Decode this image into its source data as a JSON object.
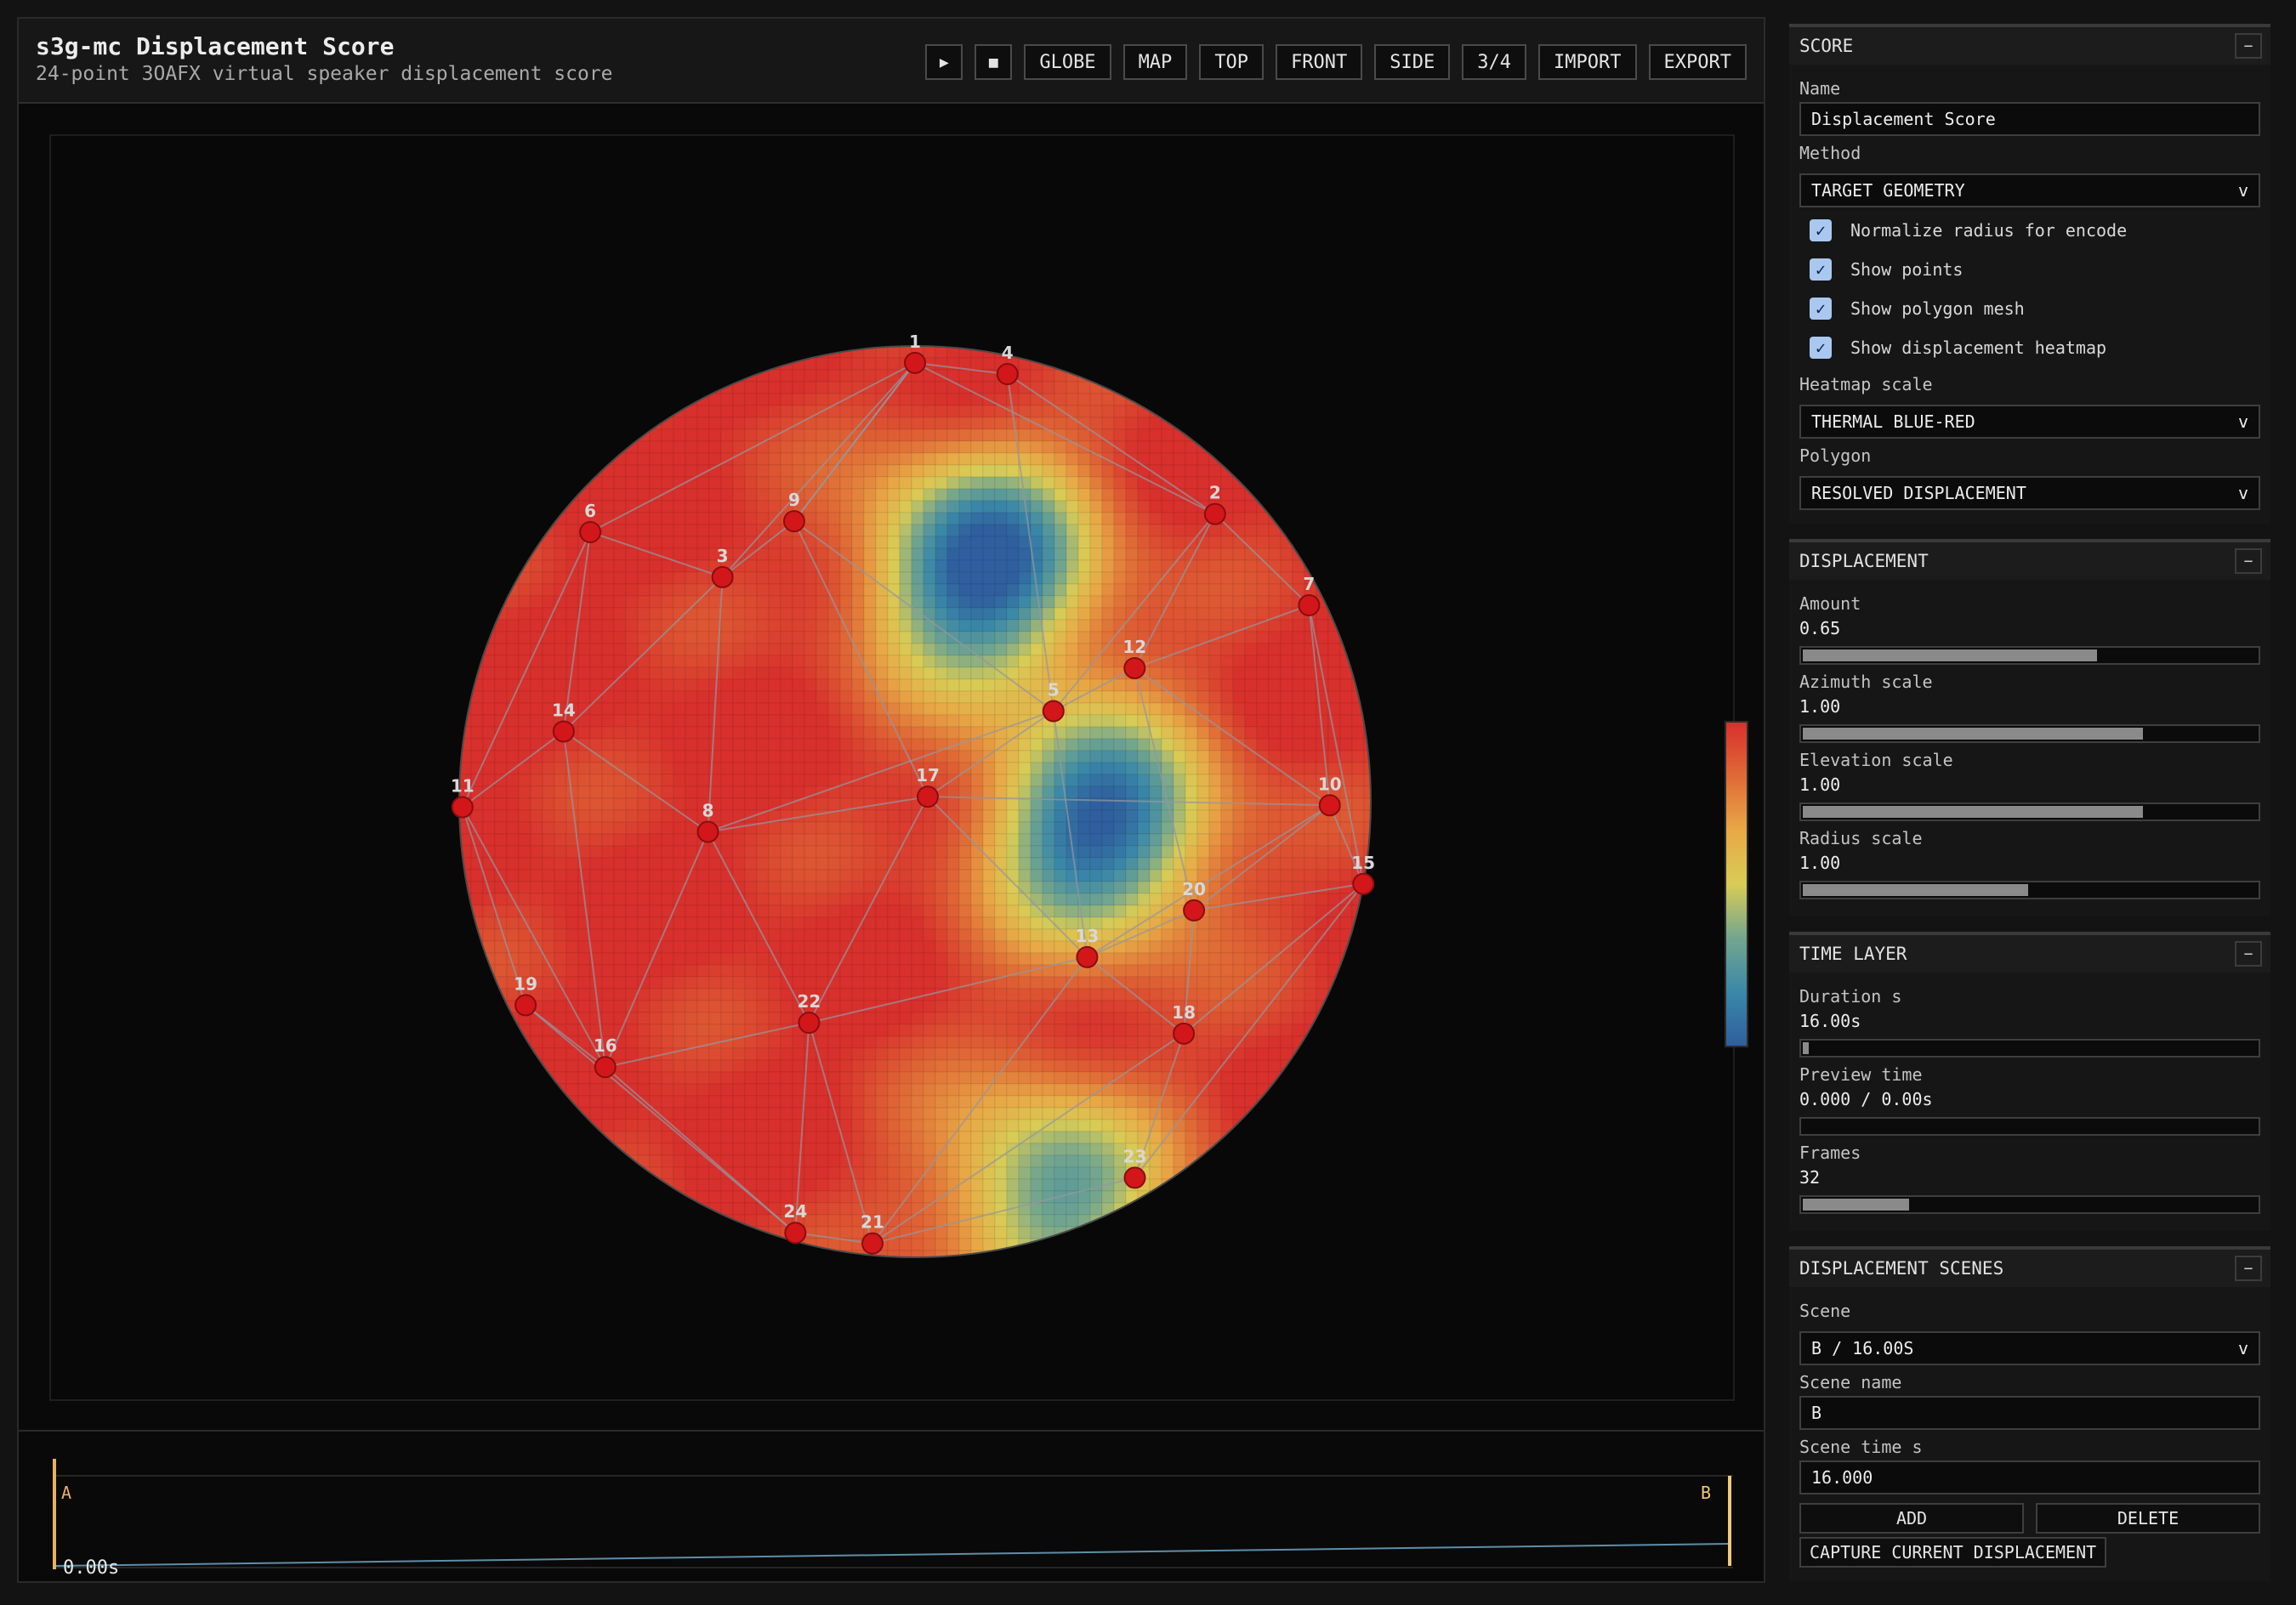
{
  "header": {
    "title": "s3g-mc Displacement Score",
    "subtitle": "24-point 3OAFX virtual speaker displacement score"
  },
  "toolbar": {
    "play_icon": "▶",
    "stop_icon": "■",
    "buttons": [
      "GLOBE",
      "MAP",
      "TOP",
      "FRONT",
      "SIDE",
      "3/4",
      "IMPORT",
      "EXPORT"
    ]
  },
  "speakers": [
    {
      "id": "1",
      "az": 90,
      "r": 0.963
    },
    {
      "id": "2",
      "az": 43.8,
      "r": 0.912
    },
    {
      "id": "3",
      "az": 130.6,
      "r": 0.649
    },
    {
      "id": "4",
      "az": 77.8,
      "r": 0.96
    },
    {
      "id": "5",
      "az": 33.2,
      "r": 0.363
    },
    {
      "id": "6",
      "az": 140.3,
      "r": 0.926
    },
    {
      "id": "7",
      "az": 26.5,
      "r": 0.966
    },
    {
      "id": "8",
      "az": 188.3,
      "r": 0.459
    },
    {
      "id": "9",
      "az": 113.3,
      "r": 0.67
    },
    {
      "id": "10",
      "az": 359.5,
      "r": 0.91
    },
    {
      "id": "11",
      "az": 180.7,
      "r": 0.993
    },
    {
      "id": "12",
      "az": 31.3,
      "r": 0.564
    },
    {
      "id": "13",
      "az": 317.9,
      "r": 0.509
    },
    {
      "id": "14",
      "az": 168.7,
      "r": 0.786
    },
    {
      "id": "15",
      "az": 349.6,
      "r": 1.0
    },
    {
      "id": "16",
      "az": 220.6,
      "r": 0.895
    },
    {
      "id": "17",
      "az": 21.2,
      "r": 0.03
    },
    {
      "id": "18",
      "az": 319.2,
      "r": 0.779
    },
    {
      "id": "19",
      "az": 207.6,
      "r": 0.964
    },
    {
      "id": "20",
      "az": 338.7,
      "r": 0.657
    },
    {
      "id": "21",
      "az": 264.5,
      "r": 0.974
    },
    {
      "id": "22",
      "az": 244.4,
      "r": 0.538
    },
    {
      "id": "23",
      "az": 300.3,
      "r": 0.956
    },
    {
      "id": "24",
      "az": 254.5,
      "r": 0.982
    }
  ],
  "timeline": {
    "marker_a": "A",
    "marker_b": "B",
    "current_time": "0.00s",
    "marker_a_color": "#e8b060",
    "marker_b_color": "#f0c878",
    "curve_color": "#5e8ea8"
  },
  "heatmap": {
    "scale": [
      "#2f5f9e",
      "#3a88a8",
      "#74a68e",
      "#d8cc56",
      "#e8a846",
      "#e06a36",
      "#d8302c"
    ],
    "hotspots": [
      {
        "az": 74,
        "r": 0.53,
        "strength": 1.0
      },
      {
        "az": 352,
        "r": 0.41,
        "strength": 0.95
      },
      {
        "az": 289,
        "r": 0.91,
        "strength": 0.7
      }
    ]
  },
  "sidebar": {
    "score": {
      "title": "SCORE",
      "collapse": "−",
      "name_label": "Name",
      "name_value": "Displacement Score",
      "method_label": "Method",
      "method_value": "TARGET GEOMETRY",
      "checkboxes": [
        "Normalize radius for encode",
        "Show points",
        "Show polygon mesh",
        "Show displacement heatmap"
      ],
      "heatmap_scale_label": "Heatmap scale",
      "heatmap_scale_value": "THERMAL BLUE-RED",
      "polygon_label": "Polygon",
      "polygon_value": "RESOLVED DISPLACEMENT"
    },
    "displacement": {
      "title": "DISPLACEMENT",
      "collapse": "−",
      "sliders": [
        {
          "label": "Amount",
          "value": "0.65",
          "fill": 0.65
        },
        {
          "label": "Azimuth scale",
          "value": "1.00",
          "fill": 0.75
        },
        {
          "label": "Elevation scale",
          "value": "1.00",
          "fill": 0.75
        },
        {
          "label": "Radius scale",
          "value": "1.00",
          "fill": 0.5
        }
      ]
    },
    "time_layer": {
      "title": "TIME LAYER",
      "collapse": "−",
      "sliders": [
        {
          "label": "Duration s",
          "value": "16.00s",
          "fill": 0.02
        },
        {
          "label": "Preview time",
          "value": "0.000 / 0.00s",
          "fill": 0.0
        },
        {
          "label": "Frames",
          "value": "32",
          "fill": 0.24
        }
      ]
    },
    "scenes": {
      "title": "DISPLACEMENT SCENES",
      "collapse": "−",
      "scene_label": "Scene",
      "scene_value": "B / 16.00S",
      "scene_name_label": "Scene name",
      "scene_name_value": "B",
      "scene_time_label": "Scene time s",
      "scene_time_value": "16.000",
      "add_label": "ADD",
      "delete_label": "DELETE",
      "capture_label": "CAPTURE CURRENT DISPLACEMENT"
    },
    "dropdown_caret": "v"
  }
}
